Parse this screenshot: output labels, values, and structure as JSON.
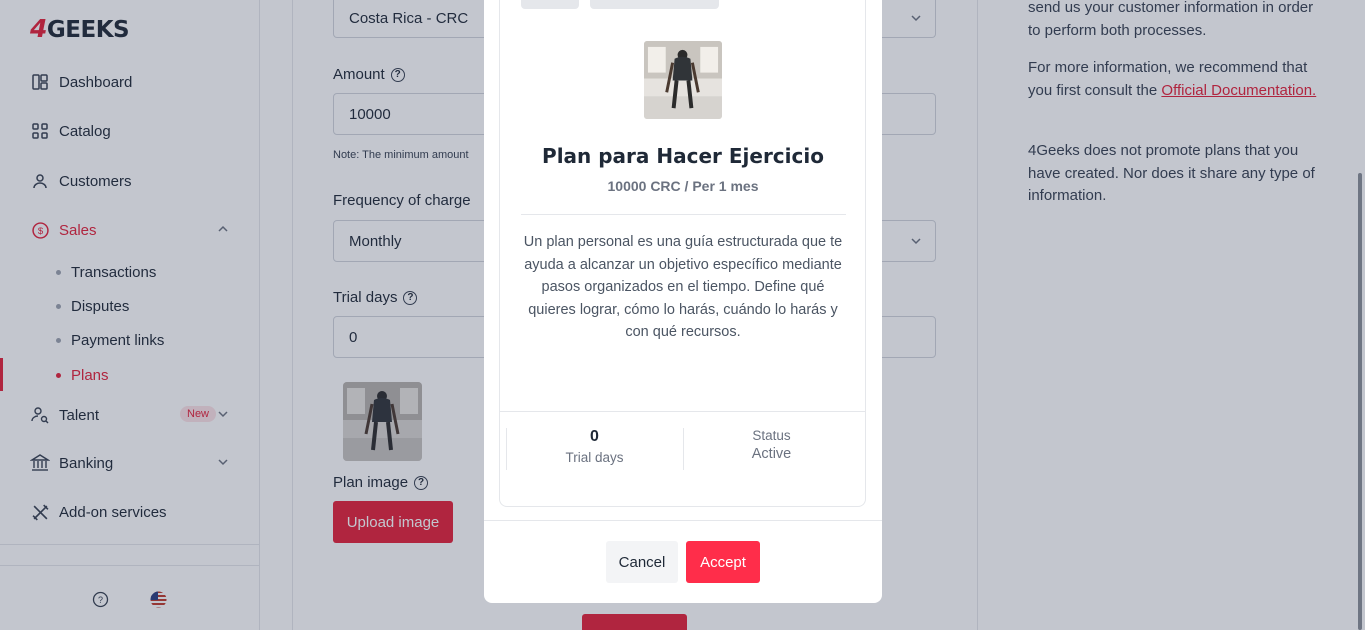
{
  "sidebar": {
    "logo_four": "4",
    "logo_text": "GEEKS",
    "items": [
      {
        "label": "Dashboard",
        "icon": "dashboard-icon"
      },
      {
        "label": "Catalog",
        "icon": "grid-icon"
      },
      {
        "label": "Customers",
        "icon": "user-icon"
      },
      {
        "label": "Sales",
        "icon": "dollar-circle-icon"
      },
      {
        "label": "Talent",
        "icon": "user-search-icon"
      },
      {
        "label": "Banking",
        "icon": "bank-icon"
      },
      {
        "label": "Add-on services",
        "icon": "tools-icon"
      }
    ],
    "sales_sub": [
      "Transactions",
      "Disputes",
      "Payment links",
      "Plans"
    ],
    "talent_badge": "New"
  },
  "form": {
    "currency_value": "Costa Rica - CRC",
    "amount_label": "Amount",
    "amount_value": "10000",
    "note": "Note: The minimum amount",
    "frequency_label": "Frequency of charge",
    "frequency_value": "Monthly",
    "trial_label": "Trial days",
    "trial_value": "0",
    "plan_image_label": "Plan image",
    "upload_button": "Upload image"
  },
  "info": {
    "p1": "send us your customer information in order to perform both processes.",
    "p2_prefix": "For more information, we recommend that you first consult the ",
    "p2_link": "Official Documentation.",
    "p3": "4Geeks does not promote plans that you have created. Nor does it share any type of information."
  },
  "modal": {
    "title": "Plan para Hacer Ejercicio",
    "price": "10000 CRC / Per 1 mes",
    "description": "Un plan personal es una guía estructurada que te ayuda a alcanzar un objetivo específico mediante pasos organizados en el tiempo. Define qué quieres lograr, cómo lo harás, cuándo lo harás y con qué recursos.",
    "trial_days_value": "0",
    "trial_days_label": "Trial days",
    "status_label": "Status",
    "status_value": "Active",
    "cancel_button": "Cancel",
    "accept_button": "Accept"
  },
  "colors": {
    "brand": "#e5203a",
    "accept": "#ff2d4a"
  }
}
